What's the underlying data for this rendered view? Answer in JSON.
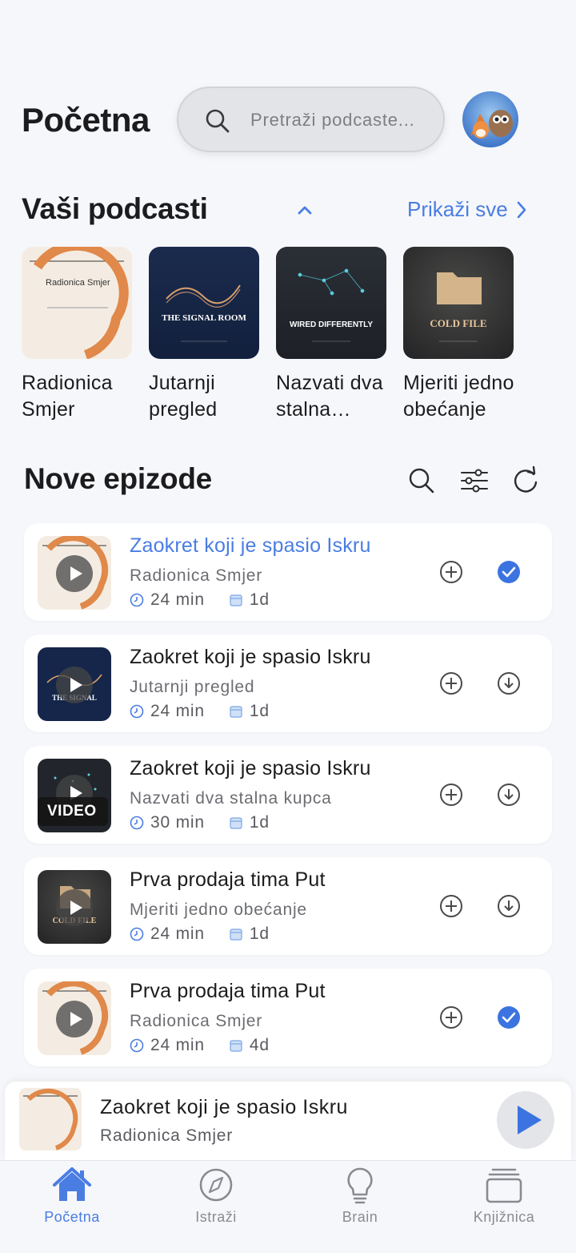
{
  "header": {
    "title": "Početna",
    "search_placeholder": "Pretraži podcaste..."
  },
  "podcasts_section": {
    "title": "Vaši podcasti",
    "show_all": "Prikaži sve",
    "items": [
      {
        "name": "Radionica Smjer",
        "cover_text": "Radionica Smjer",
        "cover_style": "light"
      },
      {
        "name": "Jutarnji pregled",
        "cover_text": "THE SIGNAL ROOM",
        "cover_style": "navy"
      },
      {
        "name": "Nazvati dva stalna kupca",
        "cover_text": "WIRED DIFFERENTLY",
        "cover_style": "dark"
      },
      {
        "name": "Mjeriti jedno obećanje",
        "cover_text": "COLD FILE",
        "cover_style": "charcoal"
      }
    ]
  },
  "episodes_section": {
    "title": "Nove epizode",
    "items": [
      {
        "title": "Zaokret koji je spasio Iskru",
        "show": "Radionica Smjer",
        "duration": "24 min",
        "age": "1d",
        "active": true,
        "status": "done",
        "badge": ""
      },
      {
        "title": "Zaokret koji je spasio Iskru",
        "show": "Jutarnji pregled",
        "duration": "24 min",
        "age": "1d",
        "active": false,
        "status": "download",
        "badge": ""
      },
      {
        "title": "Zaokret koji je spasio Iskru",
        "show": "Nazvati dva stalna kupca",
        "duration": "30 min",
        "age": "1d",
        "active": false,
        "status": "download",
        "badge": "VIDEO"
      },
      {
        "title": "Prva prodaja tima Put",
        "show": "Mjeriti jedno obećanje",
        "duration": "24 min",
        "age": "1d",
        "active": false,
        "status": "download",
        "badge": ""
      },
      {
        "title": "Prva prodaja tima Put",
        "show": "Radionica Smjer",
        "duration": "24 min",
        "age": "4d",
        "active": false,
        "status": "done",
        "badge": ""
      }
    ]
  },
  "mini_player": {
    "title": "Zaokret koji je spasio Iskru",
    "show": "Radionica Smjer"
  },
  "tabs": [
    {
      "label": "Početna",
      "icon": "home-icon",
      "active": true
    },
    {
      "label": "Istraži",
      "icon": "compass-icon",
      "active": false
    },
    {
      "label": "Brain",
      "icon": "lightbulb-icon",
      "active": false
    },
    {
      "label": "Knjižnica",
      "icon": "library-icon",
      "active": false
    }
  ],
  "colors": {
    "accent": "#4a7de2",
    "background": "#f6f7fa"
  }
}
